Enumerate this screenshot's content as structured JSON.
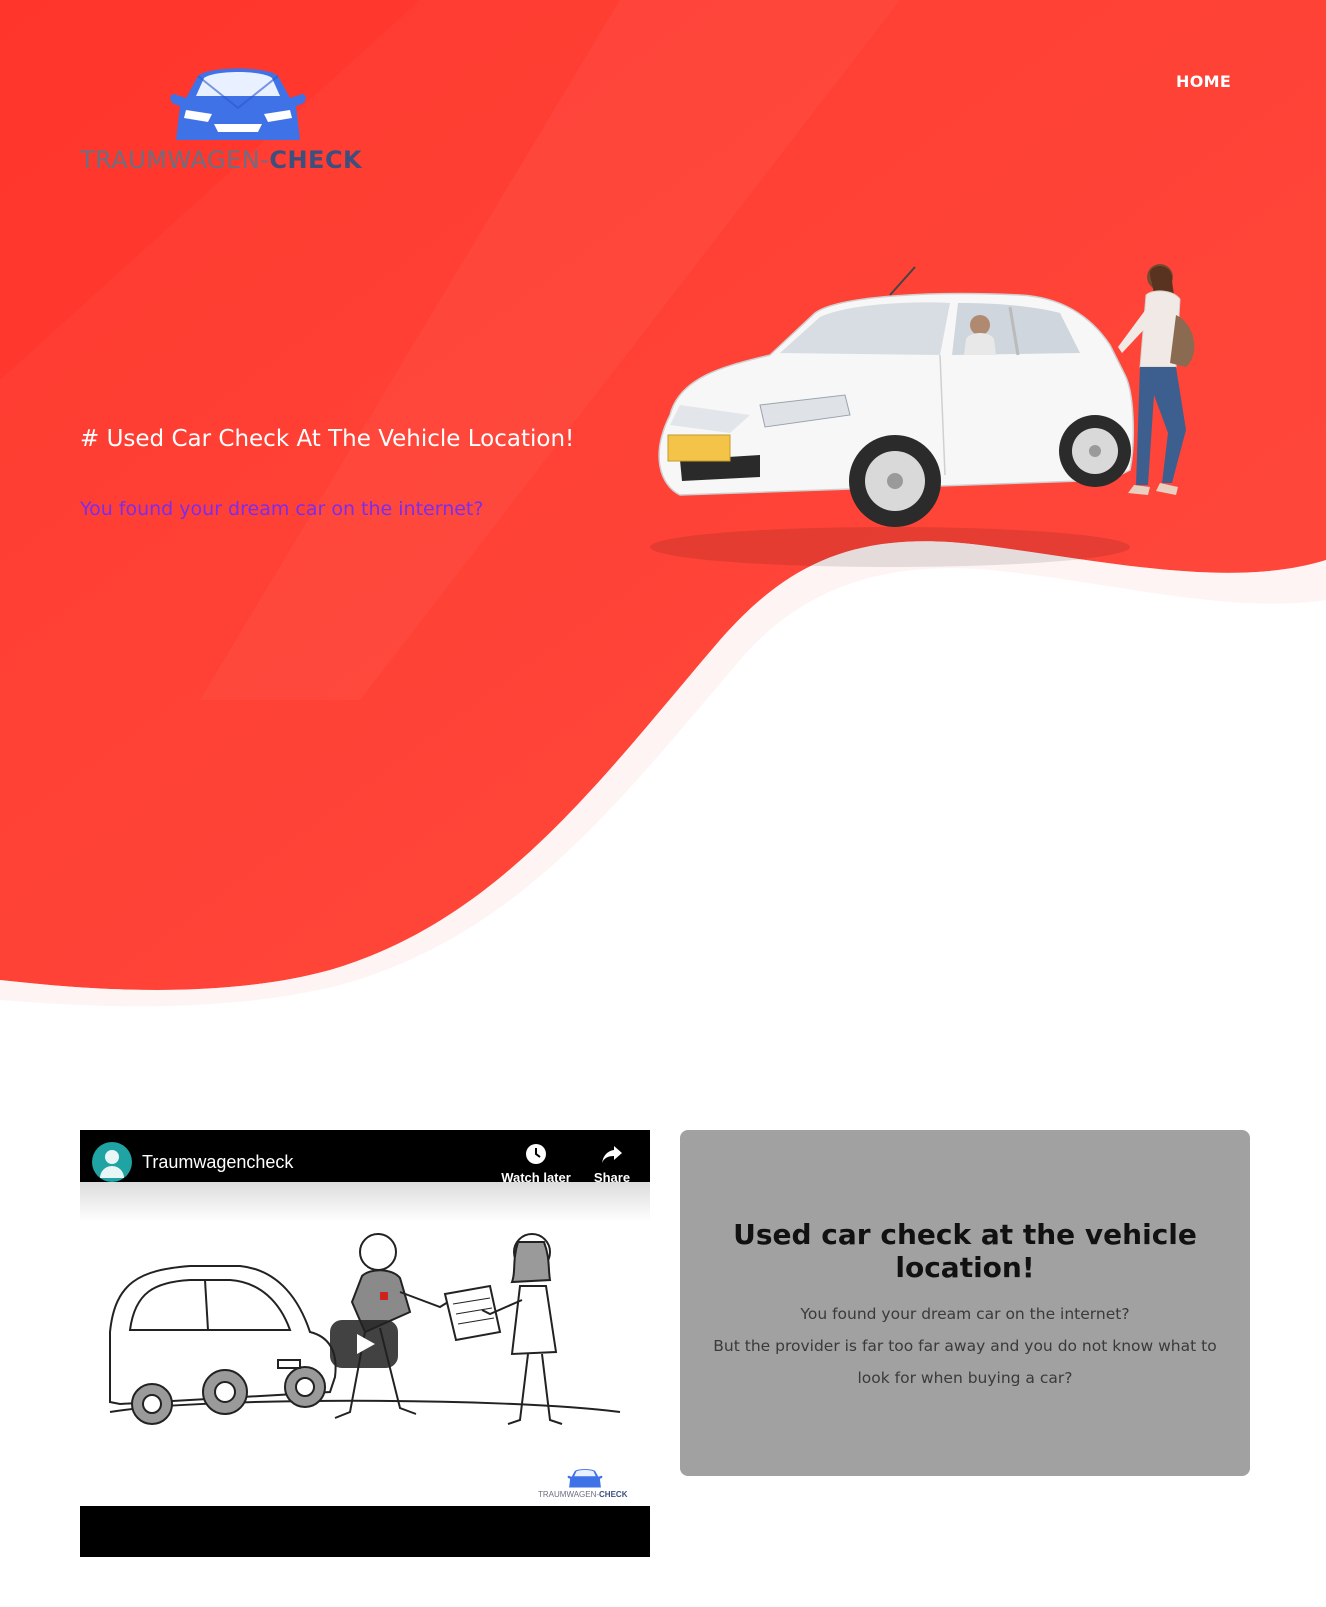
{
  "brand": {
    "logo_text_light": "TRAUMWAGEN-",
    "logo_text_bold": "CHECK",
    "logo_icon": "car-logo-icon",
    "primary_color": "#ff3b30",
    "accent_blue": "#3f72e6"
  },
  "nav": {
    "home_label": "HOME"
  },
  "hero": {
    "title": "# Used Car Check At The Vehicle Location!",
    "link_text": "You found your dream car on the internet?",
    "link_color": "#7a2cf0"
  },
  "video": {
    "channel_title": "Traumwagencheck",
    "watch_later_label": "Watch later",
    "share_label": "Share",
    "play_icon": "play-icon",
    "watermark_light": "TRAUMWAGEN-",
    "watermark_bold": "CHECK"
  },
  "info": {
    "heading": "Used car check at the vehicle location!",
    "lines": [
      "You found your dream car on the internet?",
      "But the provider is far too far away and you do not know what to",
      "look for when buying a car?"
    ],
    "card_color": "#a1a1a1"
  }
}
